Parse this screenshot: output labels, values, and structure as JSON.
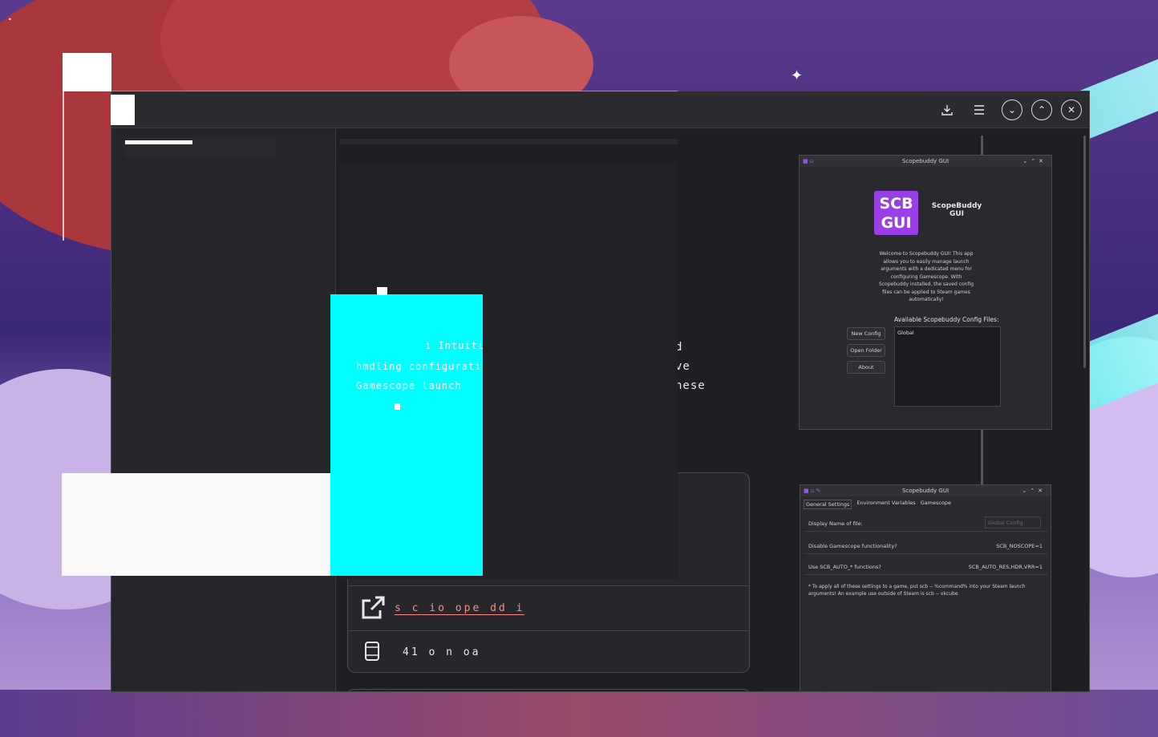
{
  "window": {
    "buttons": {
      "install": "download-icon",
      "menu": "hamburger-menu-icon",
      "minimize": "chevron-down-icon",
      "maximize": "chevron-up-icon",
      "close": "close-icon"
    }
  },
  "description": {
    "line1": "i  Intuiti",
    "line2": "hmdling configurati",
    "line3": "Gamescope  launch",
    "right1": "d",
    "right2": "ve",
    "right3": "hese"
  },
  "info_rows": [
    {
      "icon": "external-link-icon",
      "text": "s       c          io ope  dd     i"
    },
    {
      "icon": "download-size-icon",
      "text": "41          o n oa"
    }
  ],
  "screenshot1": {
    "title": "Scopebuddy GUI",
    "logo_line1": "SCB",
    "logo_line2": "GUI",
    "app_name": "ScopeBuddy\nGUI",
    "welcome": "Welcome to Scopebuddy GUI! This app allows you to easily manage launch arguments with a dedicated menu for configuring Gamescope. With Scopebuddy installed, the saved config files can be applied to Steam games automatically!",
    "link_word": "Scopebuddy",
    "available_label": "Available Scopebuddy Config Files:",
    "buttons": [
      "New Config",
      "Open Folder",
      "About"
    ],
    "list_items": [
      "Global"
    ]
  },
  "screenshot2": {
    "title": "Scopebuddy GUI",
    "tabs": [
      "General Settings",
      "Environment Variables",
      "Gamescope"
    ],
    "display_name_label": "Display Name of file:",
    "display_name_placeholder": "Global Config",
    "disable_label": "Disable Gamescope functionality?",
    "disable_value": "SCB_NOSCOPE=1",
    "auto_label": "Use SCB_AUTO_* functions?",
    "auto_value": "SCB_AUTO_RES,HDR,VRR=1",
    "note": "* To apply all of these settings to a game, put scb -- %command% into your Steam launch arguments! An example use outside of Steam is scb -- vkcube"
  },
  "colors": {
    "accent": "#9a3fe8",
    "link": "#ff8a8a",
    "glitch_cyan": "#00ffff"
  }
}
